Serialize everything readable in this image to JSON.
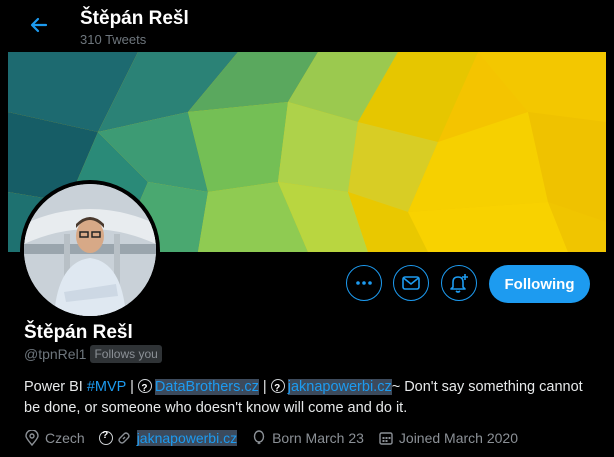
{
  "header": {
    "name": "Štěpán Rešl",
    "tweet_count": "310 Tweets"
  },
  "profile": {
    "name": "Štěpán Rešl",
    "handle": "@tpnRel1",
    "follows_you": "Follows you"
  },
  "actions": {
    "follow_label": "Following"
  },
  "bio": {
    "prefix": "Power BI ",
    "hashtag": "#MVP",
    "sep1": " | ",
    "link1": "DataBrothers.cz",
    "sep2": " | ",
    "link2": "jaknapowerbi.cz",
    "text": "~ Don't say something cannot be done, or someone who doesn't know will come and do it."
  },
  "meta": {
    "location": "Czech",
    "website": "jaknapowerbi.cz",
    "born": "Born March 23",
    "joined": "Joined March 2020"
  },
  "colors": {
    "accent": "#1d9bf0",
    "banner_teal": "#1c6b70",
    "banner_green": "#7cc258",
    "banner_yellow": "#f2c500"
  },
  "icons": [
    "back-arrow-icon",
    "more-icon",
    "mail-icon",
    "bell-plus-icon",
    "location-icon",
    "link-icon",
    "balloon-icon",
    "calendar-icon"
  ]
}
